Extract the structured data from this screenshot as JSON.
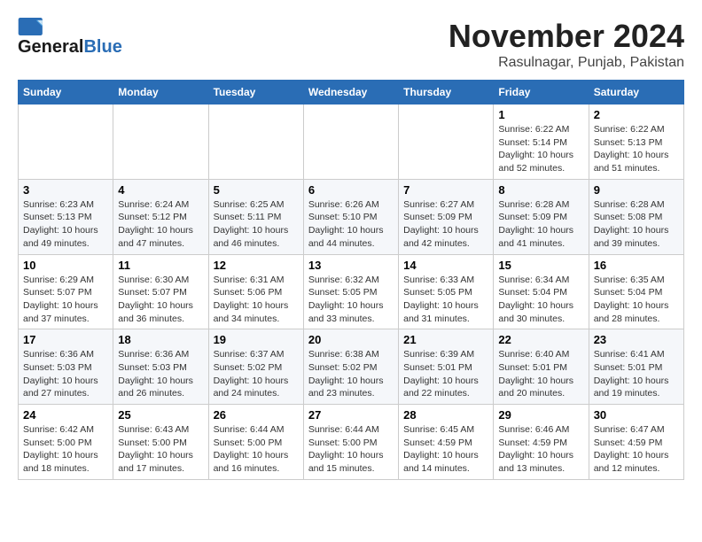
{
  "header": {
    "logo_line1": "General",
    "logo_line2": "Blue",
    "month": "November 2024",
    "location": "Rasulnagar, Punjab, Pakistan"
  },
  "weekdays": [
    "Sunday",
    "Monday",
    "Tuesday",
    "Wednesday",
    "Thursday",
    "Friday",
    "Saturday"
  ],
  "weeks": [
    [
      {
        "day": "",
        "info": ""
      },
      {
        "day": "",
        "info": ""
      },
      {
        "day": "",
        "info": ""
      },
      {
        "day": "",
        "info": ""
      },
      {
        "day": "",
        "info": ""
      },
      {
        "day": "1",
        "info": "Sunrise: 6:22 AM\nSunset: 5:14 PM\nDaylight: 10 hours\nand 52 minutes."
      },
      {
        "day": "2",
        "info": "Sunrise: 6:22 AM\nSunset: 5:13 PM\nDaylight: 10 hours\nand 51 minutes."
      }
    ],
    [
      {
        "day": "3",
        "info": "Sunrise: 6:23 AM\nSunset: 5:13 PM\nDaylight: 10 hours\nand 49 minutes."
      },
      {
        "day": "4",
        "info": "Sunrise: 6:24 AM\nSunset: 5:12 PM\nDaylight: 10 hours\nand 47 minutes."
      },
      {
        "day": "5",
        "info": "Sunrise: 6:25 AM\nSunset: 5:11 PM\nDaylight: 10 hours\nand 46 minutes."
      },
      {
        "day": "6",
        "info": "Sunrise: 6:26 AM\nSunset: 5:10 PM\nDaylight: 10 hours\nand 44 minutes."
      },
      {
        "day": "7",
        "info": "Sunrise: 6:27 AM\nSunset: 5:09 PM\nDaylight: 10 hours\nand 42 minutes."
      },
      {
        "day": "8",
        "info": "Sunrise: 6:28 AM\nSunset: 5:09 PM\nDaylight: 10 hours\nand 41 minutes."
      },
      {
        "day": "9",
        "info": "Sunrise: 6:28 AM\nSunset: 5:08 PM\nDaylight: 10 hours\nand 39 minutes."
      }
    ],
    [
      {
        "day": "10",
        "info": "Sunrise: 6:29 AM\nSunset: 5:07 PM\nDaylight: 10 hours\nand 37 minutes."
      },
      {
        "day": "11",
        "info": "Sunrise: 6:30 AM\nSunset: 5:07 PM\nDaylight: 10 hours\nand 36 minutes."
      },
      {
        "day": "12",
        "info": "Sunrise: 6:31 AM\nSunset: 5:06 PM\nDaylight: 10 hours\nand 34 minutes."
      },
      {
        "day": "13",
        "info": "Sunrise: 6:32 AM\nSunset: 5:05 PM\nDaylight: 10 hours\nand 33 minutes."
      },
      {
        "day": "14",
        "info": "Sunrise: 6:33 AM\nSunset: 5:05 PM\nDaylight: 10 hours\nand 31 minutes."
      },
      {
        "day": "15",
        "info": "Sunrise: 6:34 AM\nSunset: 5:04 PM\nDaylight: 10 hours\nand 30 minutes."
      },
      {
        "day": "16",
        "info": "Sunrise: 6:35 AM\nSunset: 5:04 PM\nDaylight: 10 hours\nand 28 minutes."
      }
    ],
    [
      {
        "day": "17",
        "info": "Sunrise: 6:36 AM\nSunset: 5:03 PM\nDaylight: 10 hours\nand 27 minutes."
      },
      {
        "day": "18",
        "info": "Sunrise: 6:36 AM\nSunset: 5:03 PM\nDaylight: 10 hours\nand 26 minutes."
      },
      {
        "day": "19",
        "info": "Sunrise: 6:37 AM\nSunset: 5:02 PM\nDaylight: 10 hours\nand 24 minutes."
      },
      {
        "day": "20",
        "info": "Sunrise: 6:38 AM\nSunset: 5:02 PM\nDaylight: 10 hours\nand 23 minutes."
      },
      {
        "day": "21",
        "info": "Sunrise: 6:39 AM\nSunset: 5:01 PM\nDaylight: 10 hours\nand 22 minutes."
      },
      {
        "day": "22",
        "info": "Sunrise: 6:40 AM\nSunset: 5:01 PM\nDaylight: 10 hours\nand 20 minutes."
      },
      {
        "day": "23",
        "info": "Sunrise: 6:41 AM\nSunset: 5:01 PM\nDaylight: 10 hours\nand 19 minutes."
      }
    ],
    [
      {
        "day": "24",
        "info": "Sunrise: 6:42 AM\nSunset: 5:00 PM\nDaylight: 10 hours\nand 18 minutes."
      },
      {
        "day": "25",
        "info": "Sunrise: 6:43 AM\nSunset: 5:00 PM\nDaylight: 10 hours\nand 17 minutes."
      },
      {
        "day": "26",
        "info": "Sunrise: 6:44 AM\nSunset: 5:00 PM\nDaylight: 10 hours\nand 16 minutes."
      },
      {
        "day": "27",
        "info": "Sunrise: 6:44 AM\nSunset: 5:00 PM\nDaylight: 10 hours\nand 15 minutes."
      },
      {
        "day": "28",
        "info": "Sunrise: 6:45 AM\nSunset: 4:59 PM\nDaylight: 10 hours\nand 14 minutes."
      },
      {
        "day": "29",
        "info": "Sunrise: 6:46 AM\nSunset: 4:59 PM\nDaylight: 10 hours\nand 13 minutes."
      },
      {
        "day": "30",
        "info": "Sunrise: 6:47 AM\nSunset: 4:59 PM\nDaylight: 10 hours\nand 12 minutes."
      }
    ]
  ]
}
